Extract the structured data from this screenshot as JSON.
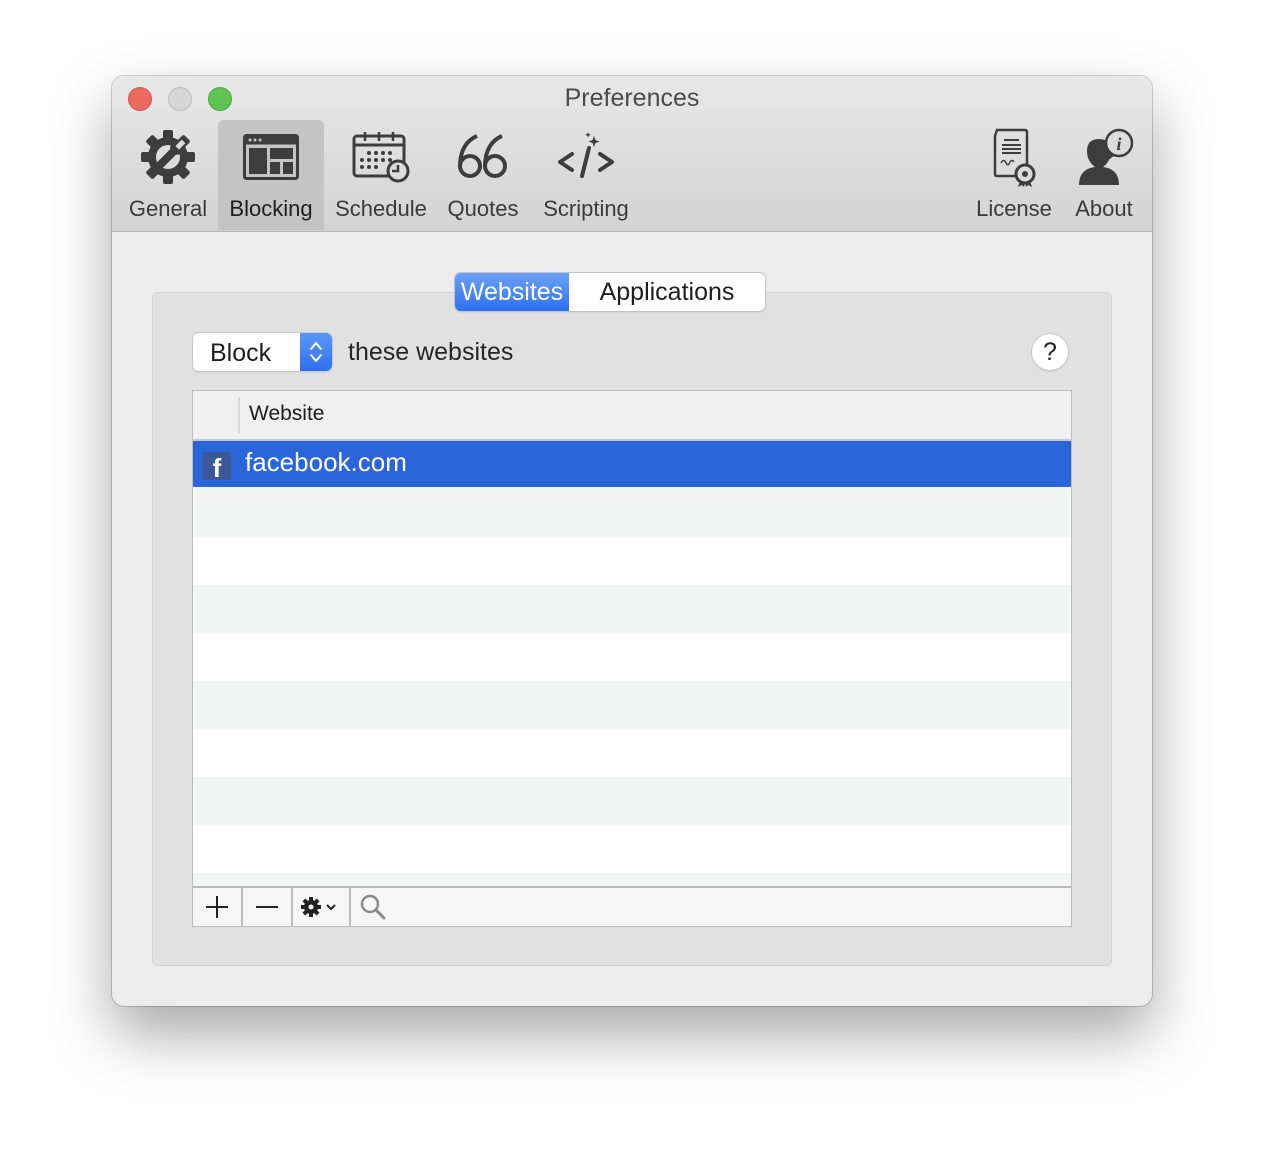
{
  "window": {
    "title": "Preferences",
    "controls": [
      "close",
      "minimize",
      "zoom"
    ]
  },
  "toolbar": {
    "items": [
      {
        "label": "General",
        "icon": "gear-wrench-icon",
        "active": false
      },
      {
        "label": "Blocking",
        "icon": "browser-window-icon",
        "active": true
      },
      {
        "label": "Schedule",
        "icon": "calendar-clock-icon",
        "active": false
      },
      {
        "label": "Quotes",
        "icon": "quote-marks-icon",
        "active": false
      },
      {
        "label": "Scripting",
        "icon": "code-sparkle-icon",
        "active": false
      },
      {
        "label": "License",
        "icon": "certificate-icon",
        "active": false
      },
      {
        "label": "About",
        "icon": "person-info-icon",
        "active": false
      }
    ]
  },
  "segmented": {
    "options": [
      "Websites",
      "Applications"
    ],
    "selected": "Websites"
  },
  "mode": {
    "selected": "Block",
    "suffix": "these websites",
    "help_label": "?"
  },
  "table": {
    "columns": [
      "Website"
    ],
    "rows": [
      {
        "favicon": "f",
        "website": "facebook.com",
        "selected": true
      }
    ]
  },
  "footer": {
    "add_label": "+",
    "remove_label": "—",
    "actions_icon": "gear-icon",
    "search_icon": "search-icon"
  },
  "colors": {
    "accent": "#2e6ff0",
    "selection": "#2a65d9",
    "facebook": "#3b5998",
    "close": "#ee6a5e",
    "minimize": "#d6d6d6",
    "zoom": "#5fc454"
  }
}
